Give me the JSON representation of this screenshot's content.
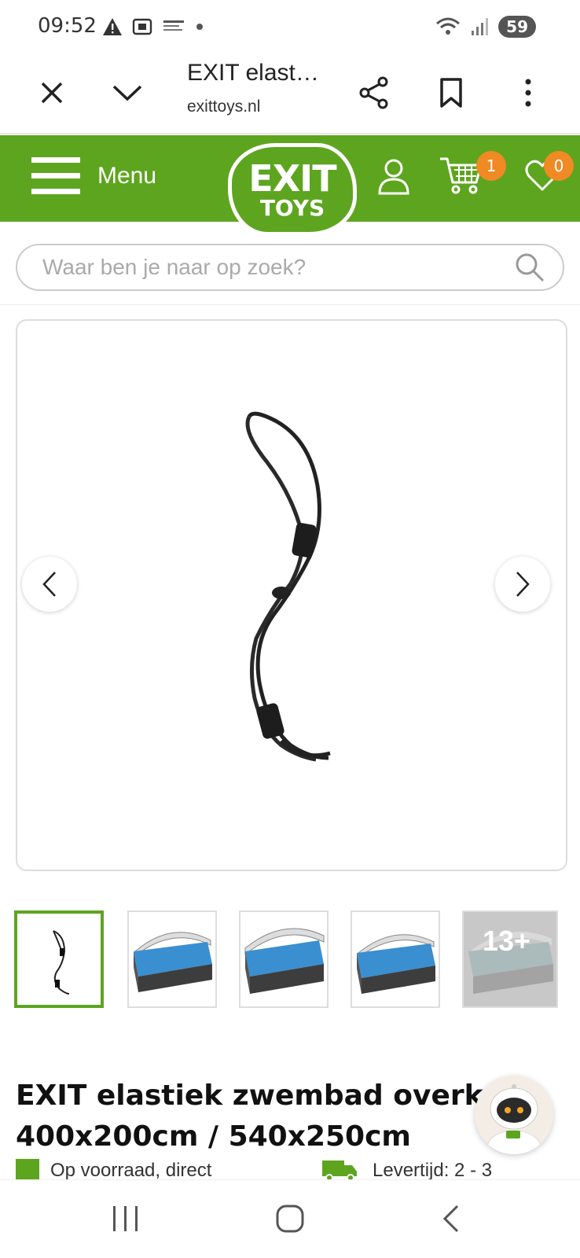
{
  "status_bar": {
    "time": "09:52",
    "battery": "59"
  },
  "browser": {
    "title": "EXIT elast…",
    "url": "exittoys.nl"
  },
  "header": {
    "menu_label": "Menu",
    "logo_line1": "EXIT",
    "logo_line2": "TOYS",
    "cart_count": "1",
    "wishlist_count": "0",
    "brand_color": "#5da51f",
    "badge_color": "#f08a24"
  },
  "search": {
    "placeholder": "Waar ben je naar op zoek?"
  },
  "gallery": {
    "more_label": "13+"
  },
  "product": {
    "title_line1": "EXIT elastiek zwembad overkapp",
    "title_line2": "400x200cm / 540x250cm",
    "stock_text": "Op voorraad, direct",
    "delivery_text": "Levertijd: 2 - 3"
  }
}
